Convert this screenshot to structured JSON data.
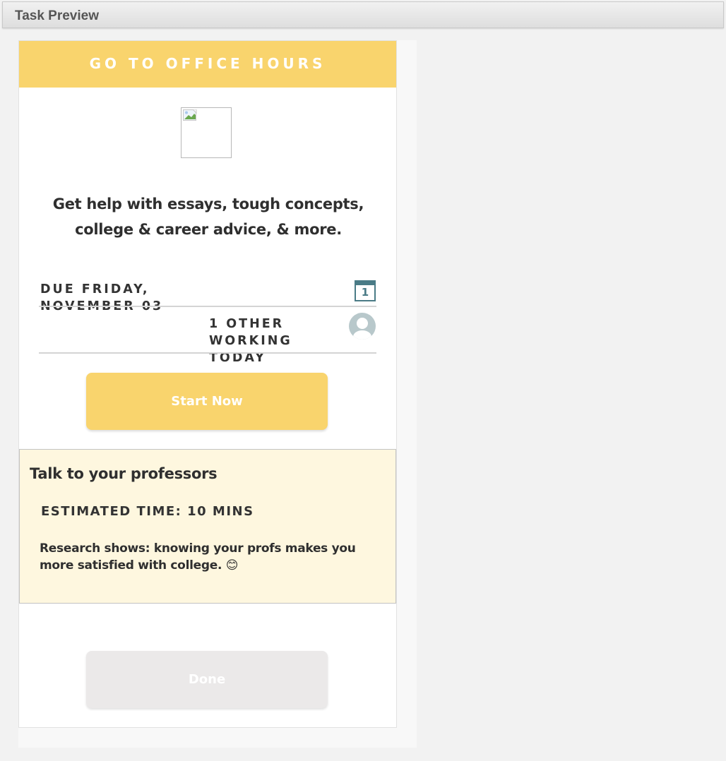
{
  "window": {
    "title": "Task Preview"
  },
  "task": {
    "header": "GO TO OFFICE HOURS",
    "description": "Get help with essays, tough concepts, college & career advice, & more.",
    "due_line1": "DUE FRIDAY,",
    "due_line2": "NOVEMBER 03",
    "calendar_day": "1",
    "others_line1": "1 OTHER",
    "others_line2": "WORKING",
    "others_line3": "TODAY",
    "start_label": "Start Now",
    "done_label": "Done"
  },
  "info": {
    "title": "Talk to your professors",
    "estimated_time": "ESTIMATED TIME: 10 MINS",
    "text": "Research shows: knowing your profs makes you more satisfied with college. 😊"
  },
  "colors": {
    "accent_yellow": "#f9d46d",
    "info_background": "#fef7df",
    "calendar_teal": "#4a7b86",
    "done_gray": "#ebe9e9"
  }
}
